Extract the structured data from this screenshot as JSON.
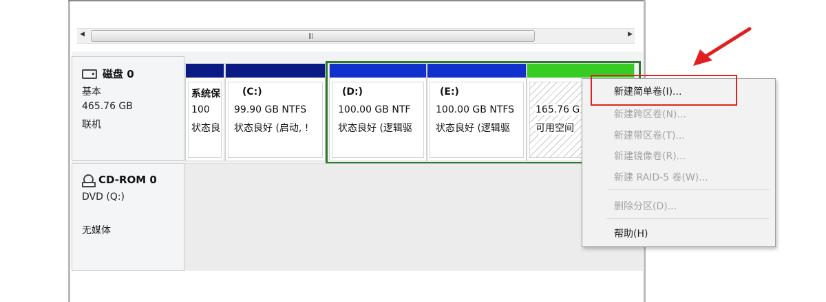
{
  "disks": [
    {
      "title": "磁盘 0",
      "type": "基本",
      "size": "465.76 GB",
      "status": "联机",
      "partitions": [
        {
          "name": "系统保",
          "size": "100",
          "status": "状态良"
        },
        {
          "name": "(C:)",
          "size": "99.90 GB NTFS",
          "status": "状态良好 (启动, !"
        },
        {
          "name": "(D:)",
          "size": "100.00 GB NTF",
          "status": "状态良好 (逻辑驱"
        },
        {
          "name": "(E:)",
          "size": "100.00 GB NTFS",
          "status": "状态良好 (逻辑驱"
        },
        {
          "name": "",
          "size": "165.76 G",
          "status": "可用空间"
        }
      ]
    },
    {
      "title": "CD-ROM 0",
      "type": "DVD (Q:)",
      "status": "无媒体"
    }
  ],
  "context_menu": {
    "items": [
      {
        "label": "新建简单卷(I)...",
        "enabled": true
      },
      {
        "label": "新建跨区卷(N)...",
        "enabled": false
      },
      {
        "label": "新建带区卷(T)...",
        "enabled": false
      },
      {
        "label": "新建镜像卷(R)...",
        "enabled": false
      },
      {
        "label": "新建 RAID-5 卷(W)...",
        "enabled": false
      },
      {
        "label": "删除分区(D)...",
        "enabled": false
      },
      {
        "label": "帮助(H)",
        "enabled": true
      }
    ]
  },
  "colors": {
    "primary_bar": "#0b1b86",
    "logical_bar": "#1131cc",
    "free_bar": "#37cc24",
    "extended_frame": "#2c7a2c",
    "highlight": "#e02020"
  },
  "icons": {
    "disk": "disk-drive-icon",
    "cdrom": "cd-rom-icon",
    "scroll_left": "scroll-left-arrow-icon",
    "scroll_right": "scroll-right-arrow-icon",
    "annotation": "red-arrow-icon"
  }
}
